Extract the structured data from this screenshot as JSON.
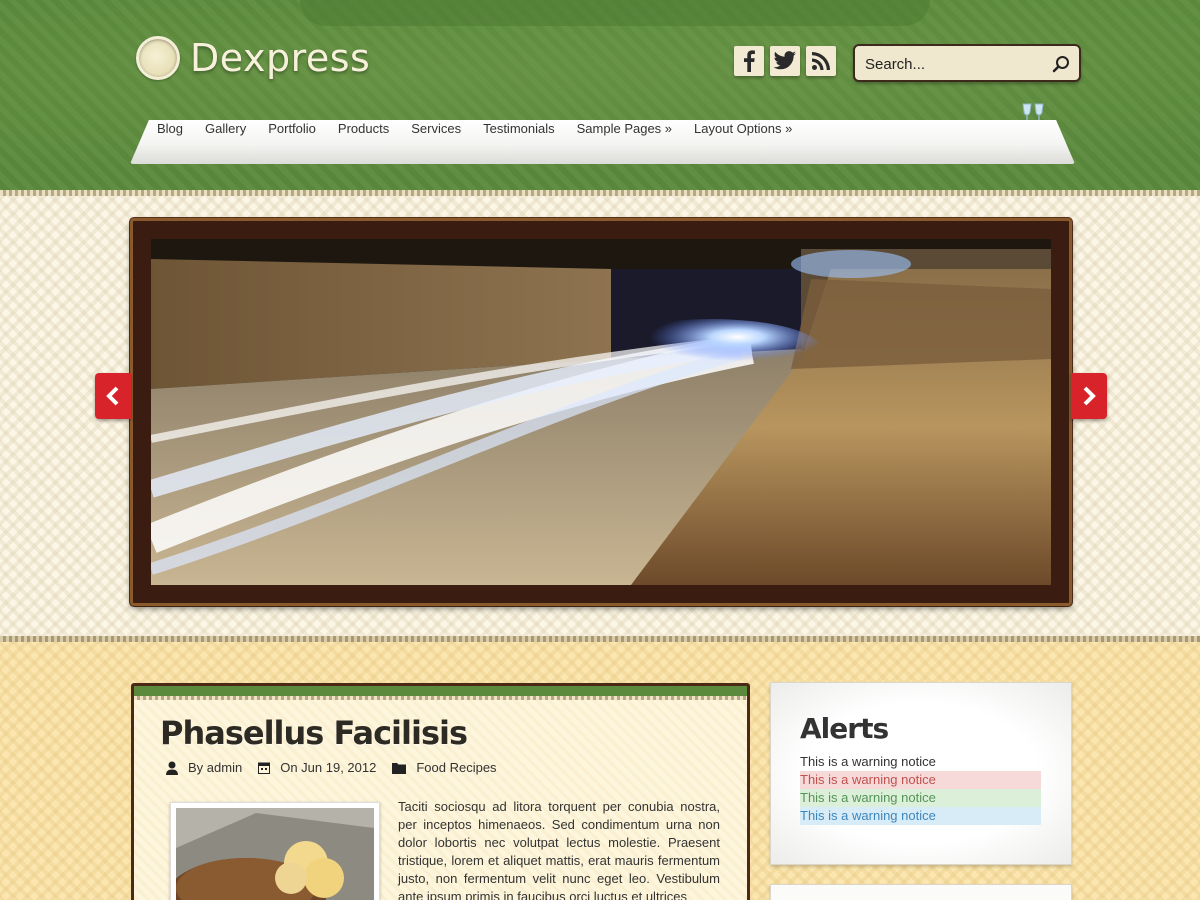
{
  "site": {
    "name": "Dexpress"
  },
  "social": [
    {
      "name": "facebook",
      "icon": "facebook-icon"
    },
    {
      "name": "twitter",
      "icon": "twitter-icon"
    },
    {
      "name": "rss",
      "icon": "rss-icon"
    }
  ],
  "search": {
    "placeholder": "Search..."
  },
  "nav": {
    "items": [
      {
        "label": "Blog"
      },
      {
        "label": "Gallery"
      },
      {
        "label": "Portfolio"
      },
      {
        "label": "Products"
      },
      {
        "label": "Services"
      },
      {
        "label": "Testimonials"
      },
      {
        "label": "Sample Pages »"
      },
      {
        "label": "Layout Options »"
      }
    ]
  },
  "slider": {
    "prev_icon": "chevron-left-icon",
    "next_icon": "chevron-right-icon"
  },
  "post": {
    "title": "Phasellus Facilisis",
    "author": "By admin",
    "date": "On Jun 19, 2012",
    "category": "Food Recipes",
    "excerpt": "Taciti sociosqu ad litora torquent per conubia nostra, per inceptos himenaeos. Sed condimentum urna non dolor lobortis nec volutpat lectus molestie. Praesent tristique, lorem et aliquet mattis, erat mauris fermentum justo, non fermentum velit nunc eget leo. Vestibulum ante ipsum primis in faucibus orci luctus et ultrices"
  },
  "sidebar": {
    "alerts_title": "Alerts",
    "alerts": [
      {
        "text": "This is a warning notice"
      },
      {
        "text": "This is a warning notice"
      },
      {
        "text": "This is a warning notice"
      },
      {
        "text": "This is a warning notice"
      }
    ]
  },
  "colors": {
    "header_green": "#5b8a3c",
    "arrow_red": "#d8232a",
    "frame_brown": "#3b1c10",
    "alert_red_text": "#c0514d",
    "alert_green_text": "#559457",
    "alert_blue_text": "#3d86bc"
  }
}
